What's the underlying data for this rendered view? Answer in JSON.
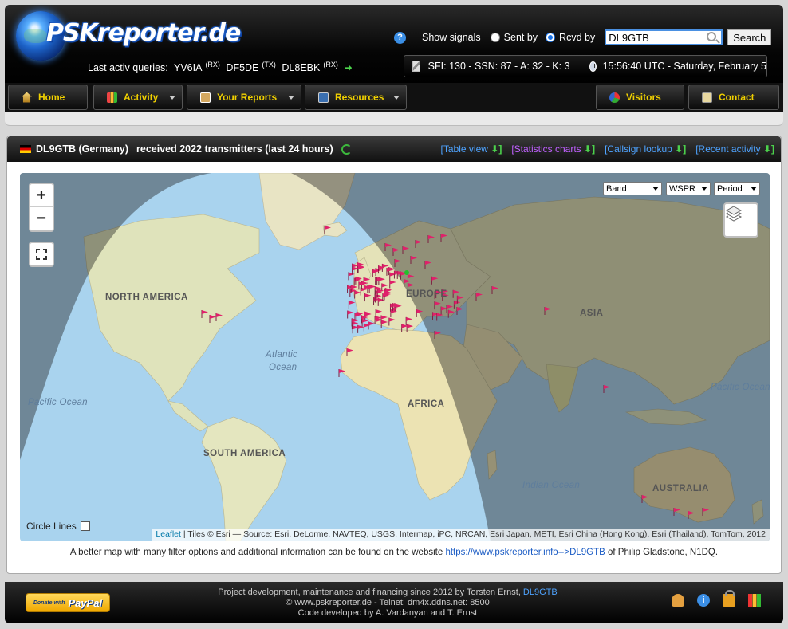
{
  "header": {
    "logo_text": "PSKreporter.de",
    "last_queries_label": "Last activ queries:",
    "last_queries": [
      {
        "call": "YV6IA",
        "mode": "(RX)"
      },
      {
        "call": "DF5DE",
        "mode": "(TX)"
      },
      {
        "call": "DL8EBK",
        "mode": "(RX)"
      }
    ],
    "arrow": "➜",
    "help": "?",
    "show_signals_label": "Show signals",
    "sent_by_label": "Sent by",
    "rcvd_by_label": "Rcvd by",
    "search_value": "DL9GTB",
    "search_button": "Search",
    "solar_text": "SFI: 130 - SSN: 87 - A: 32 - K: 3",
    "time_text": "15:56:40 UTC - Saturday, February 5"
  },
  "nav": {
    "home": "Home",
    "activity": "Activity",
    "reports": "Your Reports",
    "resources": "Resources",
    "visitors": "Visitors",
    "contact": "Contact"
  },
  "panel": {
    "station": "DL9GTB (Germany)",
    "received": "received 2022 transmitters (last 24 hours)",
    "links": [
      {
        "label": "[Table view",
        "color": "#4ea3ff"
      },
      {
        "label": "[Statistics charts",
        "color": "#c060ff"
      },
      {
        "label": "[Callsign lookup",
        "color": "#4ea3ff"
      },
      {
        "label": "[Recent activity",
        "color": "#4ea3ff"
      }
    ],
    "link_arrow": "⬇]"
  },
  "map": {
    "selects": [
      {
        "label": "Band"
      },
      {
        "label": "WSPR"
      },
      {
        "label": "Period"
      }
    ],
    "zoom_in": "+",
    "zoom_out": "−",
    "circle_lines_label": "Circle Lines",
    "attribution_leaflet": "Leaflet",
    "attribution_rest": " | Tiles © Esri — Source: Esri, DeLorme, NAVTEQ, USGS, Intermap, iPC, NRCAN, Esri Japan, METI, Esri China (Hong Kong), Esri (Thailand), TomTom, 2012",
    "labels": {
      "north_america": "NORTH AMERICA",
      "south_america": "SOUTH AMERICA",
      "europe": "EUROPE",
      "asia": "ASIA",
      "africa": "AFRICA",
      "australia": "AUSTRALIA",
      "atlantic": "Atlantic",
      "ocean": "Ocean",
      "pacific_left": "Pacific Ocean",
      "pacific_right": "Pacific Ocean —",
      "indian": "Indian Ocean"
    },
    "flag_color": "#e0206a"
  },
  "bottom_note": {
    "before": "A better map with many filter options and additional information can be found on the website ",
    "link": "https://www.pskreporter.info-->DL9GTB",
    "after": " of Philip Gladstone, N1DQ."
  },
  "footer": {
    "donate": "Donate with",
    "paypal": "PayPal",
    "line1_prefix": "Project development, maintenance and financing since 2012 by Torsten Ernst, ",
    "line1_link": "DL9GTB",
    "line2": "© www.pskreporter.de - Telnet: dm4x.ddns.net: 8500",
    "line3": "Code developed by A. Vardanyan and T. Ernst",
    "info": "i"
  }
}
